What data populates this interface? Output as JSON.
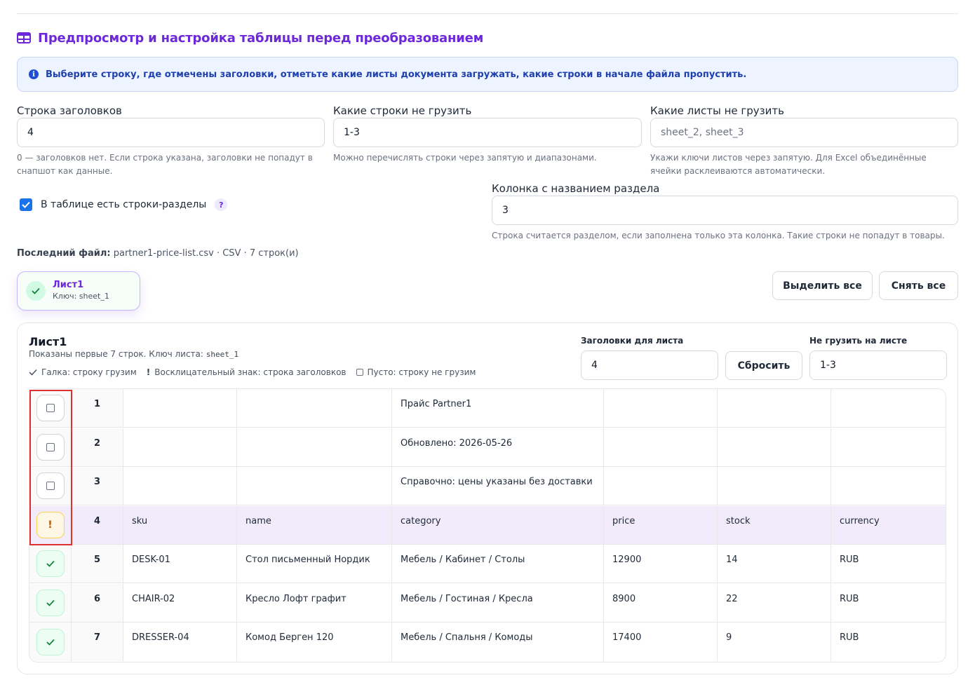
{
  "page": {
    "title": "Предпросмотр и настройка таблицы перед преобразованием",
    "info": "Выберите строку, где отмечены заголовки, отметьте какие листы документа загружать, какие строки в начале файла пропустить."
  },
  "fields": {
    "header_row": {
      "label": "Строка заголовков",
      "value": "4",
      "hint": "0 — заголовков нет. Если строка указана, заголовки не попадут в снапшот как данные."
    },
    "skip_rows": {
      "label": "Какие строки не грузить",
      "value": "1-3",
      "hint": "Можно перечислять строки через запятую и диапазонами."
    },
    "skip_sheets": {
      "label": "Какие листы не грузить",
      "placeholder": "sheet_2, sheet_3",
      "hint": "Укажи ключи листов через запятую. Для Excel объединённые ячейки расклеиваются автоматически."
    },
    "section_column": {
      "label": "Колонка с названием раздела",
      "value": "3",
      "hint": "Строка считается разделом, если заполнена только эта колонка. Такие строки не попадут в товары."
    }
  },
  "section_rows": {
    "label": "В таблице есть строки-разделы",
    "checked": true,
    "help": "?"
  },
  "last_file": {
    "label": "Последний файл:",
    "value": "partner1-price-list.csv · CSV · 7 строк(и)"
  },
  "sheet_chip": {
    "title": "Лист1",
    "key": "Ключ: sheet_1"
  },
  "buttons": {
    "select_all": "Выделить все",
    "deselect_all": "Снять все",
    "reset": "Сбросить"
  },
  "sheet_card": {
    "title": "Лист1",
    "subtitle_prefix": "Показаны первые 7 строк. Ключ листа:",
    "sheet_key": "sheet_1",
    "legend": {
      "check": "Галка: строку грузим",
      "excl": "Восклицательный знак: строка заголовков",
      "empty": "Пусто: строку не грузим"
    },
    "headers_label": "Заголовки для листа",
    "headers_value": "4",
    "skip_label": "Не грузить на листе",
    "skip_value": "1-3"
  },
  "rows": [
    {
      "num": "1",
      "state": "empty",
      "cells": [
        "",
        "",
        "Прайс Partner1",
        "",
        "",
        ""
      ]
    },
    {
      "num": "2",
      "state": "empty",
      "cells": [
        "",
        "",
        "Обновлено: 2026-05-26",
        "",
        "",
        ""
      ]
    },
    {
      "num": "3",
      "state": "empty",
      "cells": [
        "",
        "",
        "Справочно: цены указаны без доставки",
        "",
        "",
        ""
      ]
    },
    {
      "num": "4",
      "state": "header",
      "cells": [
        "sku",
        "name",
        "category",
        "price",
        "stock",
        "currency"
      ]
    },
    {
      "num": "5",
      "state": "ok",
      "cells": [
        "DESK-01",
        "Стол письменный Нордик",
        "Мебель / Кабинет / Столы",
        "12900",
        "14",
        "RUB"
      ]
    },
    {
      "num": "6",
      "state": "ok",
      "cells": [
        "CHAIR-02",
        "Кресло Лофт графит",
        "Мебель / Гостиная / Кресла",
        "8900",
        "22",
        "RUB"
      ]
    },
    {
      "num": "7",
      "state": "ok",
      "cells": [
        "DRESSER-04",
        "Комод Берген 120",
        "Мебель / Спальня / Комоды",
        "17400",
        "9",
        "RUB"
      ]
    }
  ]
}
